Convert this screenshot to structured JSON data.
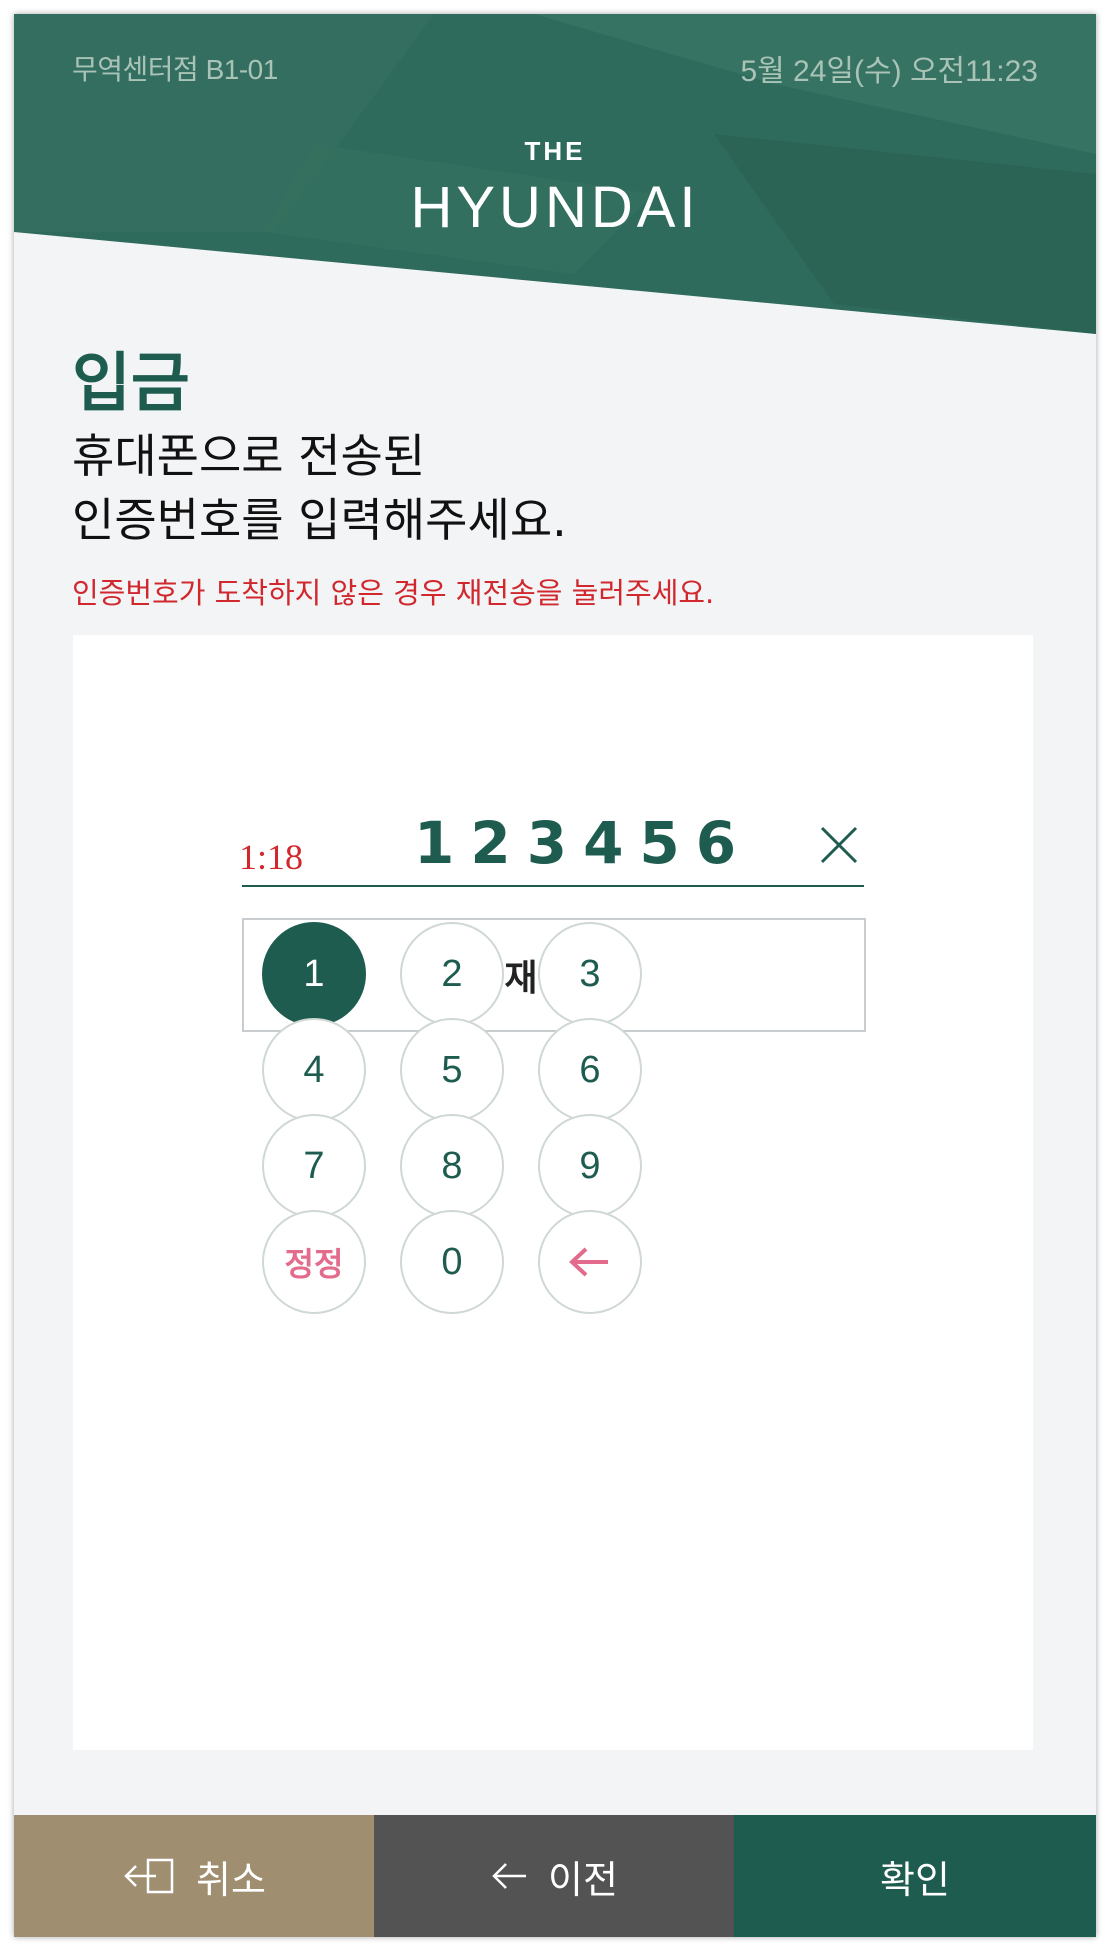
{
  "header": {
    "store_name": "무역센터점 B1-01",
    "datetime": "5월 24일(수) 오전11:23",
    "logo_top": "THE",
    "logo_main": "HYUNDAI",
    "color": "#2f6b5c"
  },
  "page": {
    "title": "입금",
    "instruction_lines": [
      "휴대폰으로 전송된",
      "인증번호를 입력해주세요."
    ],
    "notice": "인증번호가 도착하지 않은 경우 재전송을 눌러주세요."
  },
  "verification": {
    "timer": "1:18",
    "code": "123456",
    "clear_icon": "close-icon",
    "resend_label": "재전송"
  },
  "keypad": {
    "keys": [
      "1",
      "2",
      "3",
      "4",
      "5",
      "6",
      "7",
      "8",
      "9",
      "정정",
      "0",
      "←"
    ],
    "active_key": "1",
    "backspace_icon": "arrow-left-icon"
  },
  "bottom_bar": {
    "cancel": {
      "label": "취소",
      "icon": "exit-icon",
      "color": "#a08e70"
    },
    "prev": {
      "label": "이전",
      "icon": "arrow-left-icon",
      "color": "#535353"
    },
    "confirm": {
      "label": "확인",
      "color": "#1f5c50"
    }
  },
  "colors": {
    "accent": "#1f5c50",
    "warning": "#d1282e",
    "correction": "#e36b8c",
    "background": "#f3f4f6"
  }
}
